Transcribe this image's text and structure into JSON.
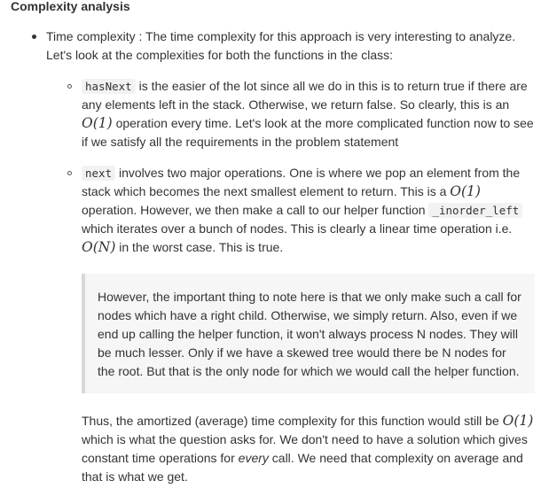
{
  "heading": "Complexity analysis",
  "item1": {
    "text": "Time complexity : The time complexity for this approach is very interesting to analyze. Let's look at the complexities for both the functions in the class:"
  },
  "sub1": {
    "code": "hasNext",
    "text_a": "is the easier of the lot since all we do in this is to return true if there are any elements left in the stack. Otherwise, we return false. So clearly, this is an",
    "math_a": "O(1)",
    "text_b": "operation every time. Let's look at the more complicated function now to see if we satisfy all the requirements in the problem statement"
  },
  "sub2": {
    "code": "next",
    "text_a": "involves two major operations. One is where we pop an element from the stack which becomes the next smallest element to return. This is a",
    "math_a": "O(1)",
    "text_b": "operation. However, we then make a call to our helper function",
    "code2": "_inorder_left",
    "text_c": "which iterates over a bunch of nodes. This is clearly a linear time operation i.e.",
    "math_b": "O(N)",
    "text_d": "in the worst case. This is true."
  },
  "quote": {
    "text": "However, the important thing to note here is that we only make such a call for nodes which have a right child. Otherwise, we simply return. Also, even if we end up calling the helper function, it won't always process N nodes. They will be much lesser. Only if we have a skewed tree would there be N nodes for the root. But that is the only node for which we would call the helper function."
  },
  "final": {
    "text_a": "Thus, the amortized (average) time complexity for this function would still be",
    "math": "O(1)",
    "text_b": "which is what the question asks for. We don't need to have a solution which gives constant time operations for",
    "emph": "every",
    "text_c": "call. We need that complexity on average and that is what we get."
  }
}
